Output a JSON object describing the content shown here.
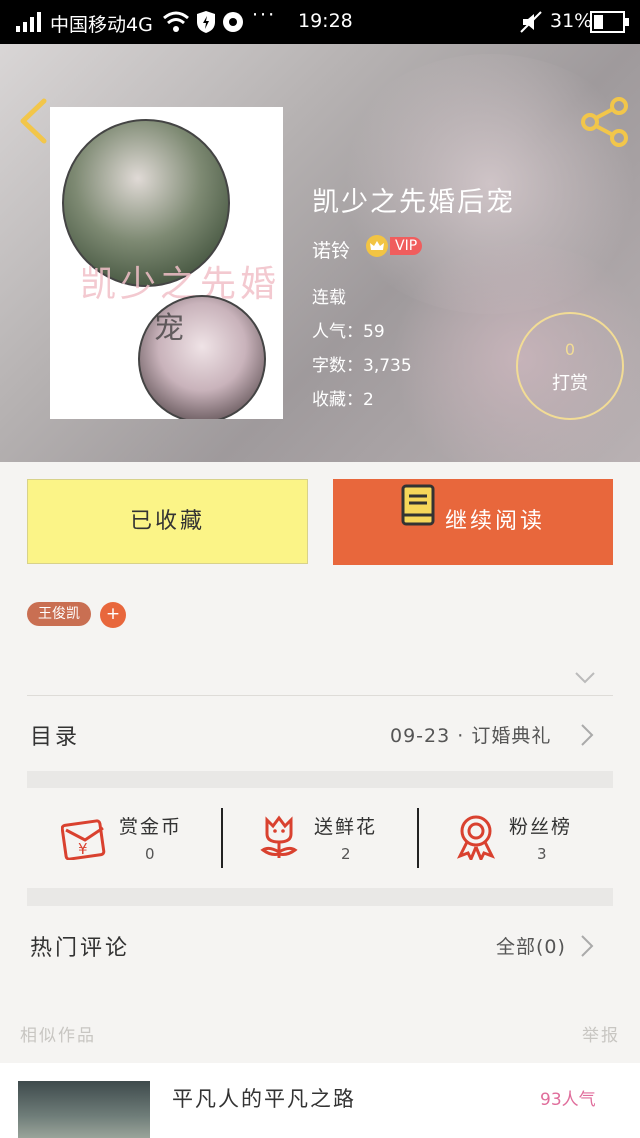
{
  "status_bar": {
    "carrier": "中国移动4G",
    "time": "19:28",
    "battery": "31%"
  },
  "book": {
    "title": "凯少之先婚后宠",
    "author": "诺铃",
    "vip": "VIP",
    "status": "连载",
    "popularity": "人气：59",
    "word_count": "字数：3,735",
    "favorites": "收藏：2",
    "reward_count": "0",
    "reward_label": "打赏",
    "cover_text": "凯少之先婚",
    "cover_text2": "宠"
  },
  "actions": {
    "favorited_label": "已收藏",
    "continue_label": "继续阅读"
  },
  "tags": [
    "王俊凯"
  ],
  "tag_add": "+",
  "catalog": {
    "label": "目录",
    "latest": "09-23 · 订婚典礼"
  },
  "stats": [
    {
      "label": "赏金币",
      "value": "0",
      "icon": "red-envelope-icon"
    },
    {
      "label": "送鲜花",
      "value": "2",
      "icon": "flower-icon"
    },
    {
      "label": "粉丝榜",
      "value": "3",
      "icon": "medal-icon"
    }
  ],
  "comments": {
    "label": "热门评论",
    "all": "全部(0)"
  },
  "similar": {
    "heading": "相似作品",
    "report": "举报",
    "items": [
      {
        "title": "平凡人的平凡之路",
        "popularity": "93人气"
      }
    ]
  },
  "colors": {
    "accent": "#e8673c",
    "favorite_bg": "#fbf487",
    "tag_bg": "#c96f52",
    "vip_bg": "#f05d5d",
    "popularity_pink": "#e06d9b"
  }
}
